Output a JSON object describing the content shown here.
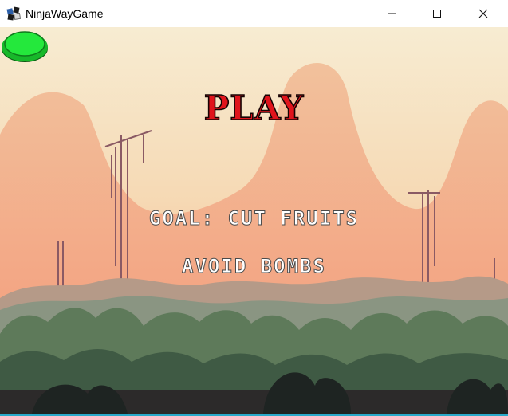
{
  "window": {
    "title": "NinjaWayGame"
  },
  "menu": {
    "play_label": "PLAY",
    "goal_text": "GOAL: CUT FRUITS",
    "avoid_text": "AVOID BOMBS"
  },
  "colors": {
    "play_text": "#e0141c",
    "play_button": "#22e03a",
    "sky_top": "#f6e6c5",
    "sky_bottom": "#f5a07c"
  },
  "icons": [
    "app-icon",
    "minimize-icon",
    "maximize-icon",
    "close-icon"
  ]
}
